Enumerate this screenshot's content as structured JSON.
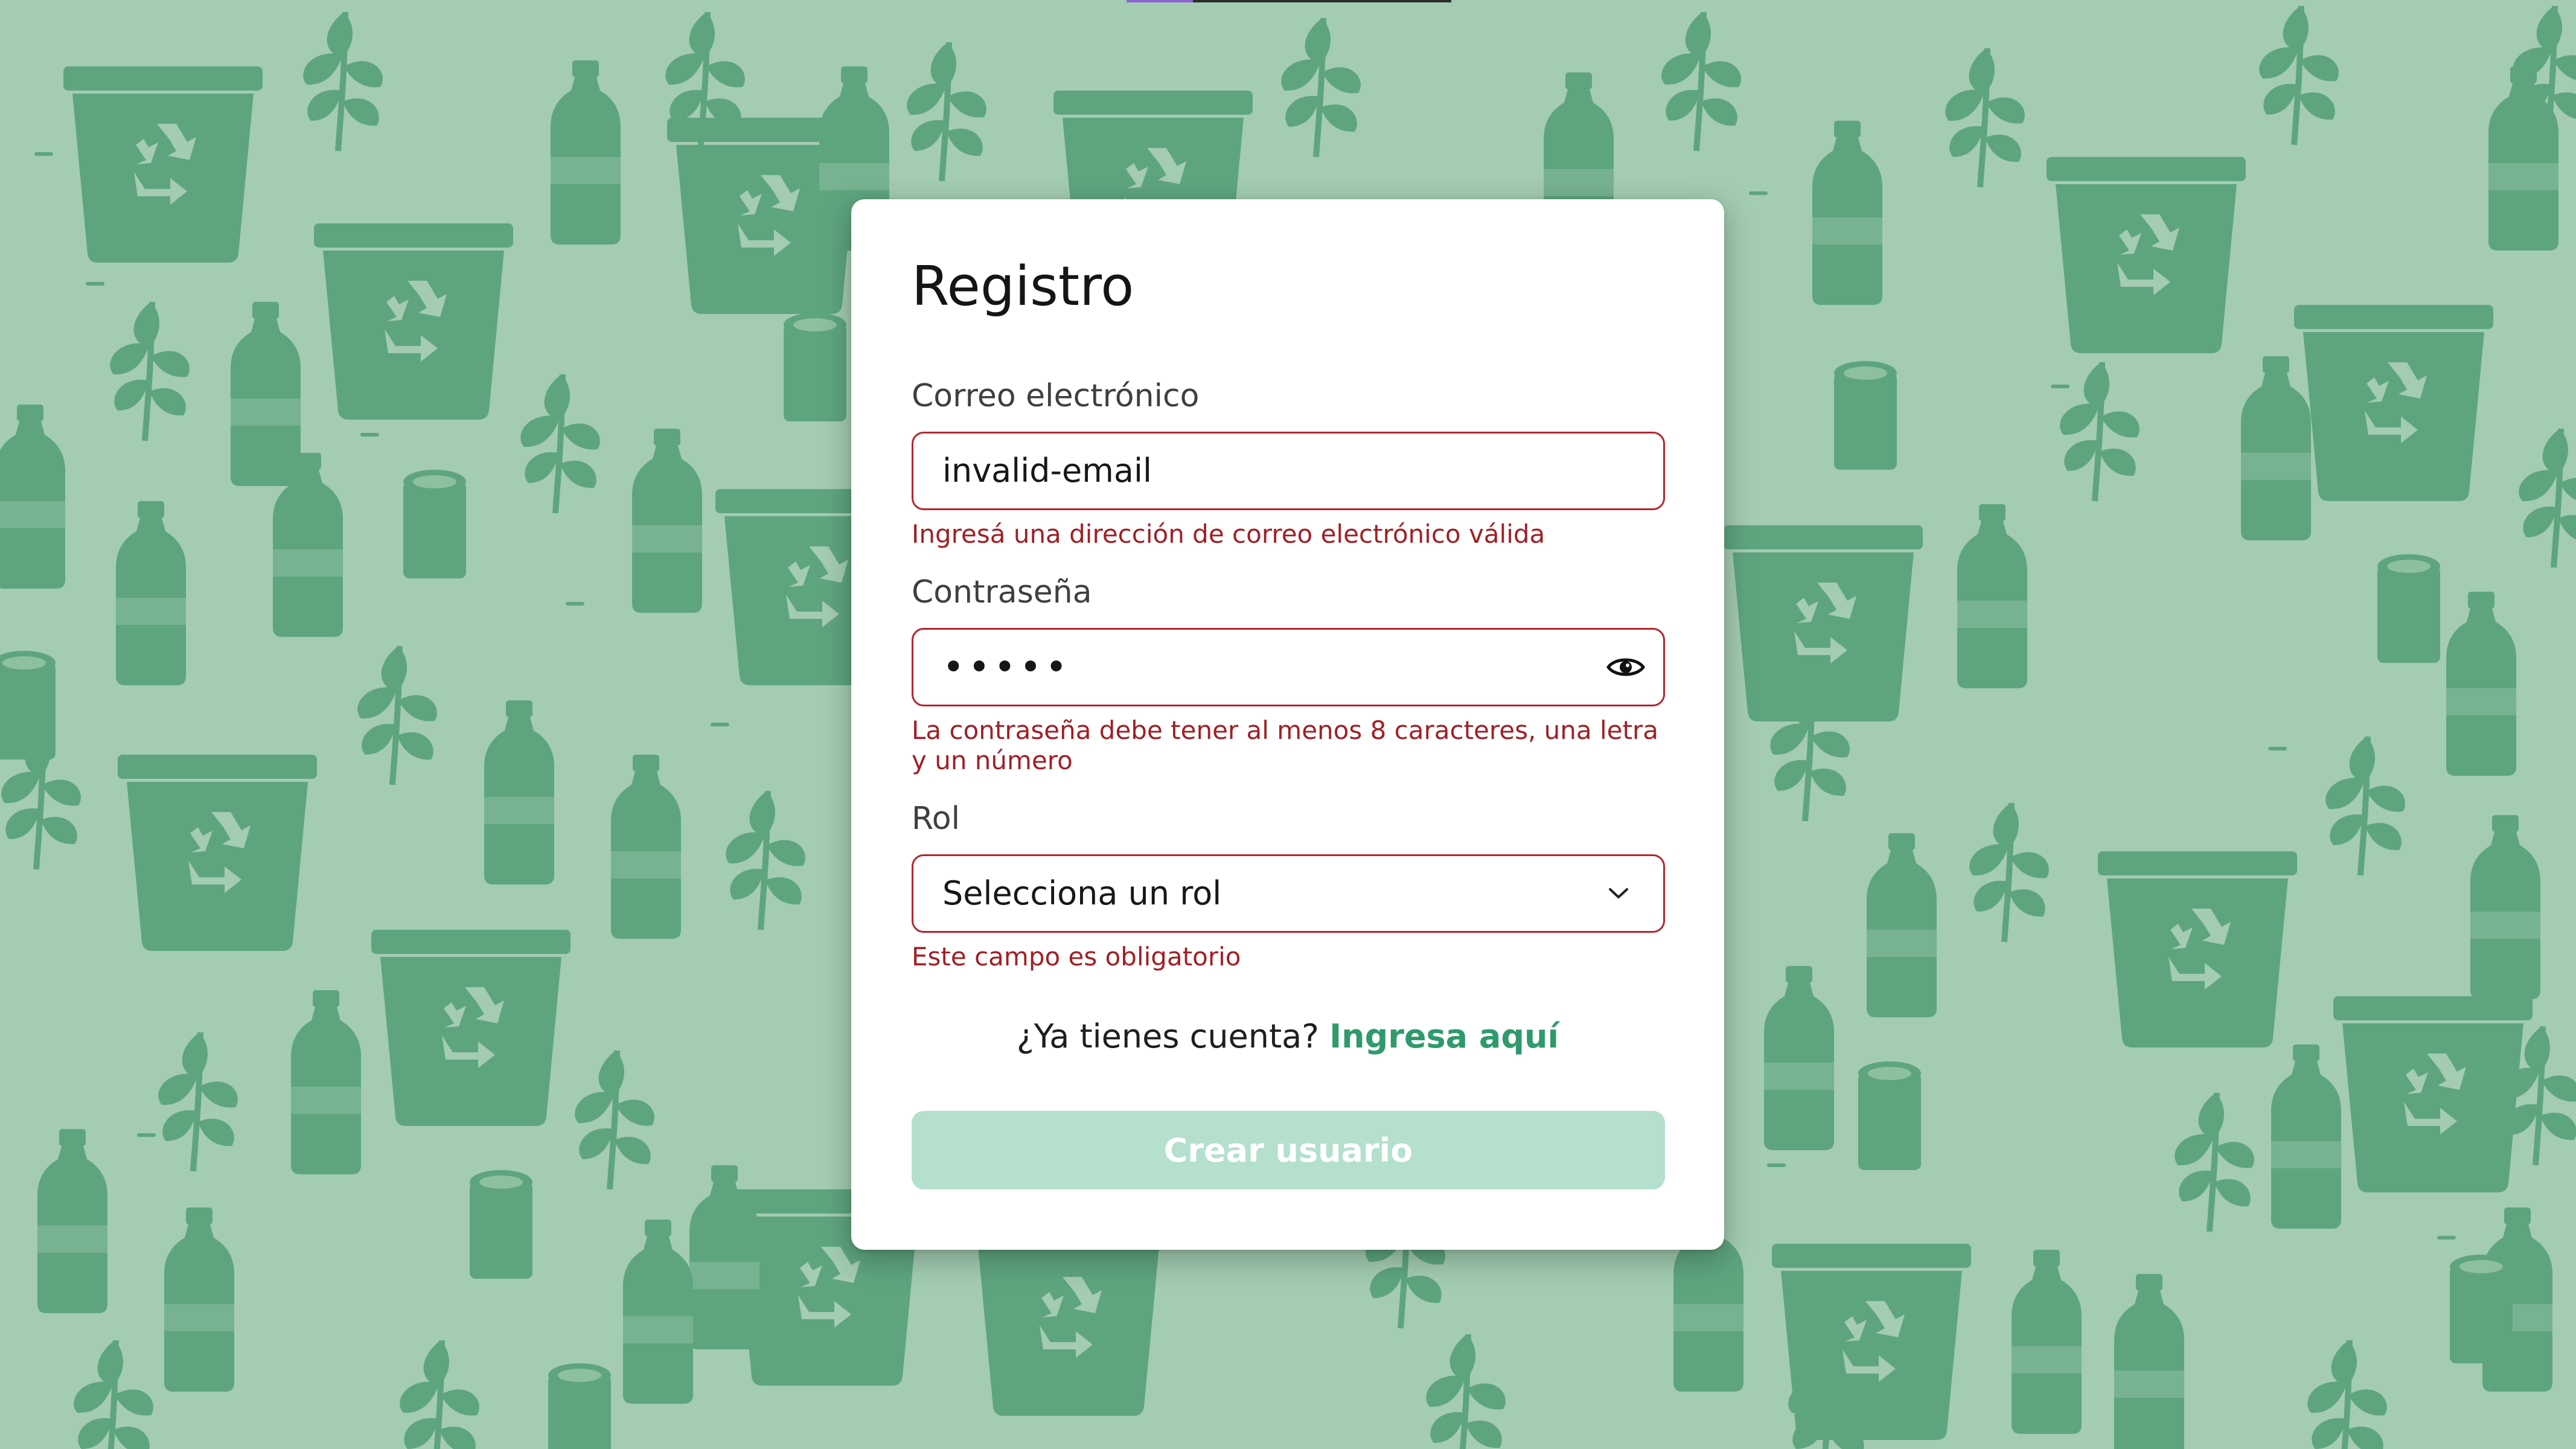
{
  "background": {
    "theme": "recycling-pattern",
    "base_color": "#a3ccb2",
    "motif_color": "#5ea57e",
    "icons": [
      "recycle-bin-icon",
      "bottle-icon",
      "leaf-sprig-icon",
      "can-icon"
    ]
  },
  "form": {
    "title": "Registro",
    "email": {
      "label": "Correo electrónico",
      "value": "invalid-email",
      "error": "Ingresá una dirección de correo electrónico válida"
    },
    "password": {
      "label": "Contraseña",
      "masked_value": "•••••",
      "toggle_icon": "eye-icon",
      "error": "La contraseña debe tener al menos 8 caracteres, una letra y un número"
    },
    "role": {
      "label": "Rol",
      "selected": "Selecciona un rol",
      "icon": "chevron-down-icon",
      "error": "Este campo es obligatorio"
    },
    "login_prompt": "¿Ya tienes cuenta?",
    "login_link": "Ingresa aquí",
    "submit_label": "Crear usuario",
    "submit_disabled": true
  },
  "colors": {
    "error": "#a11f25",
    "error_border": "#b3262e",
    "link": "#2f9a6b",
    "button_disabled": "#b4e0cd",
    "card": "#ffffff"
  }
}
